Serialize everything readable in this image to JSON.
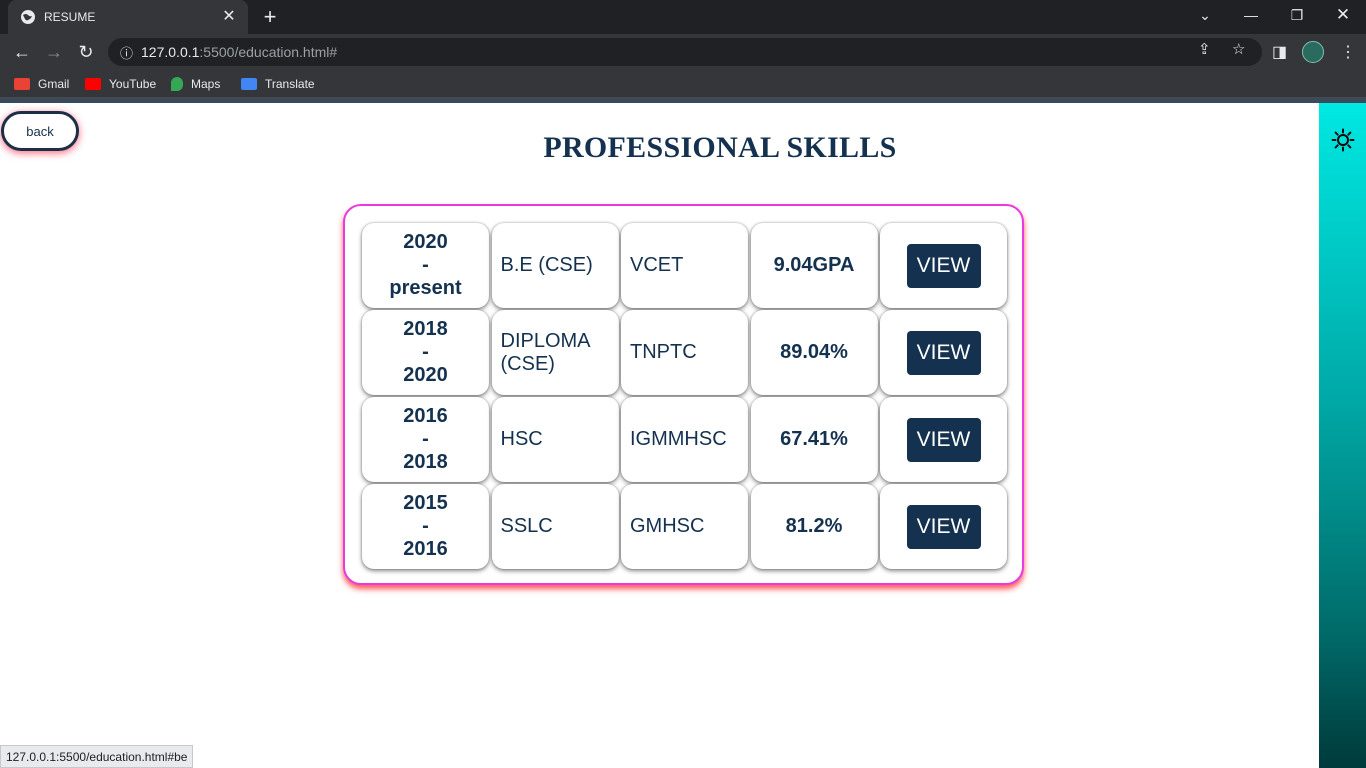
{
  "browser": {
    "tab_title": "RESUME",
    "url_host": "127.0.0.1",
    "url_path": ":5500/education.html#",
    "bookmarks": [
      {
        "label": "Gmail",
        "color": "#ea4335"
      },
      {
        "label": "YouTube",
        "color": "#ff0000"
      },
      {
        "label": "Maps",
        "color": "#34a853"
      },
      {
        "label": "Translate",
        "color": "#4285f4"
      }
    ],
    "status_url": "127.0.0.1:5500/education.html#be"
  },
  "page": {
    "back_label": "back",
    "title": "PROFESSIONAL SKILLS",
    "theme_icon": "sun-icon",
    "rows": [
      {
        "year_from": "2020",
        "sep": "-",
        "year_to": "present",
        "degree": "B.E (CSE)",
        "institution": "VCET",
        "score": "9.04GPA",
        "action": "VIEW"
      },
      {
        "year_from": "2018",
        "sep": "-",
        "year_to": "2020",
        "degree": "DIPLOMA (CSE)",
        "institution": "TNPTC",
        "score": "89.04%",
        "action": "VIEW"
      },
      {
        "year_from": "2016",
        "sep": "-",
        "year_to": "2018",
        "degree": "HSC",
        "institution": "IGMMHSC",
        "score": "67.41%",
        "action": "VIEW"
      },
      {
        "year_from": "2015",
        "sep": "-",
        "year_to": "2016",
        "degree": "SSLC",
        "institution": "GMHSC",
        "score": "81.2%",
        "action": "VIEW"
      }
    ]
  },
  "colors": {
    "primary": "#14324f",
    "card_border": "#e83ae0",
    "sidebar_top": "#00e8e3",
    "sidebar_bottom": "#003a3b"
  }
}
